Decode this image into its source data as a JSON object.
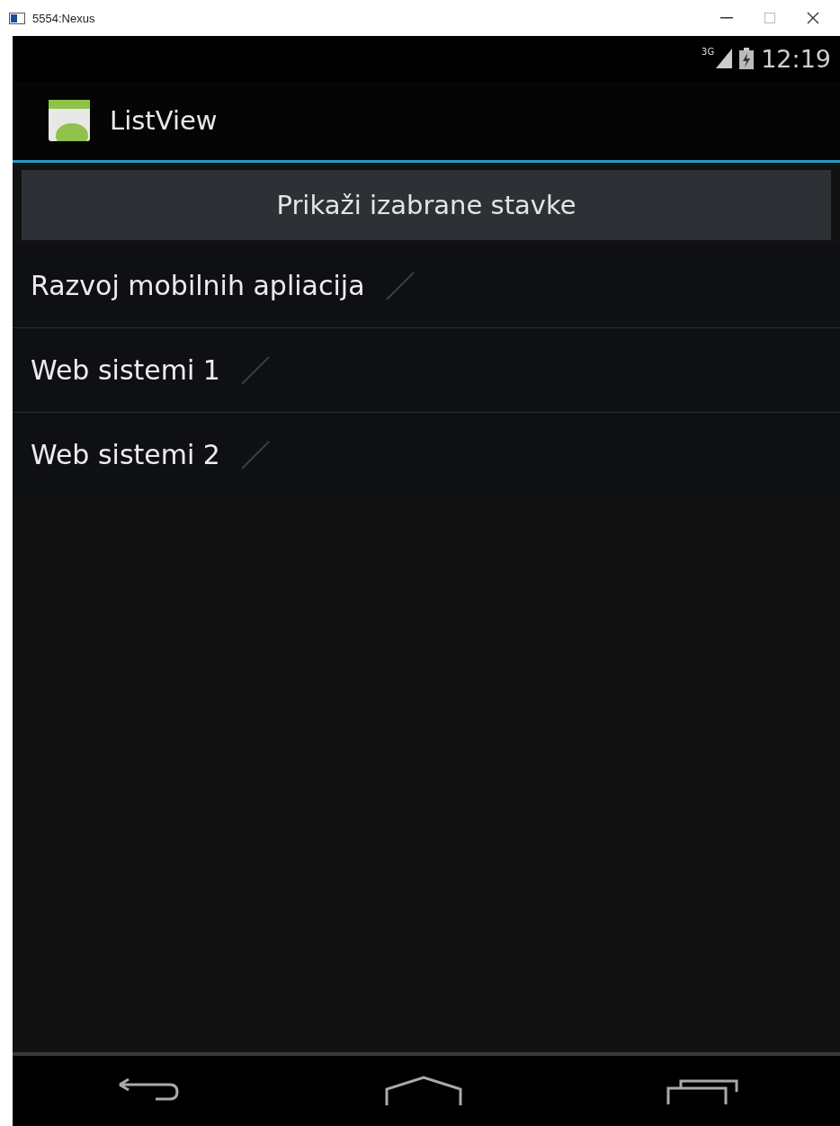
{
  "window": {
    "title": "5554:Nexus"
  },
  "status_bar": {
    "network": "3G",
    "time": "12:19"
  },
  "action_bar": {
    "title": "ListView"
  },
  "button": {
    "label": "Prikaži izabrane stavke"
  },
  "items": [
    {
      "label": "Razvoj mobilnih apliacija",
      "checked": false
    },
    {
      "label": "Web sistemi 1",
      "checked": false
    },
    {
      "label": "Web sistemi 2",
      "checked": false
    }
  ]
}
